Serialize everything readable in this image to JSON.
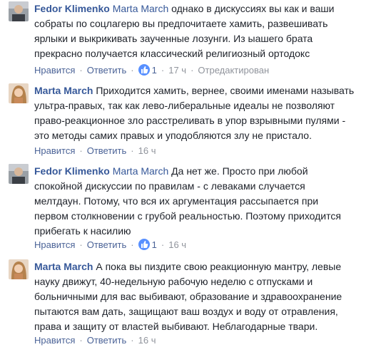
{
  "colors": {
    "author": "#365899",
    "text": "#1d2129",
    "meta": "#90949c",
    "action": "#4b6397",
    "like_badge": "#5890ff"
  },
  "comments": [
    {
      "author": "Fedor Klimenko",
      "mention": "Marta March",
      "avatar": "avatar-male-photo",
      "lines": [
        "однако в дискуссиях вы как и ваши",
        "собраты по соцлагерю вы предпочитаете хамить, развешивать",
        "ярлыки и выкрикивать заученные лозунги. Из ыашего брата",
        "прекрасно получается классический религиозный ортодокс"
      ],
      "like_label": "Нравится",
      "reply_label": "Ответить",
      "like_count": "1",
      "time": "17 ч",
      "edited": "Отредактирован"
    },
    {
      "author": "Marta March",
      "mention": "",
      "avatar": "avatar-female-photo",
      "lines": [
        "Приходится хамить, вернее, своими именами называть",
        "ультра-правых, так как лево-либеральные идеалы не позволяют",
        "право-реакционное зло расстреливать в упор взрывными пулями -",
        "это методы самих правых и уподобляются злу не пристало."
      ],
      "like_label": "Нравится",
      "reply_label": "Ответить",
      "like_count": "",
      "time": "16 ч",
      "edited": ""
    },
    {
      "author": "Fedor Klimenko",
      "mention": "Marta March",
      "avatar": "avatar-male-photo",
      "lines": [
        "Да нет же. Просто при любой",
        "спокойной дискуссии по правилам - с леваками случается",
        "мелтдаун. Потому, что вся их аргументация рассыпается при",
        "первом столкновении с грубой реальностью. Поэтому приходится",
        "прибегать к насилию"
      ],
      "like_label": "Нравится",
      "reply_label": "Ответить",
      "like_count": "1",
      "time": "16 ч",
      "edited": ""
    },
    {
      "author": "Marta March",
      "mention": "",
      "avatar": "avatar-female-photo",
      "lines": [
        "А пока вы пиздите свою реакционную мантру, левые",
        "науку движут, 40-недельную рабочую неделю с отпусками и",
        "больничными для вас выбивают, образование и здравоохранение",
        "пытаются вам дать, защищают ваш воздух и воду от отравления,",
        "права и защиту от властей выбивают. Неблагодарные твари."
      ],
      "like_label": "Нравится",
      "reply_label": "Ответить",
      "like_count": "",
      "time": "16 ч",
      "edited": ""
    }
  ]
}
